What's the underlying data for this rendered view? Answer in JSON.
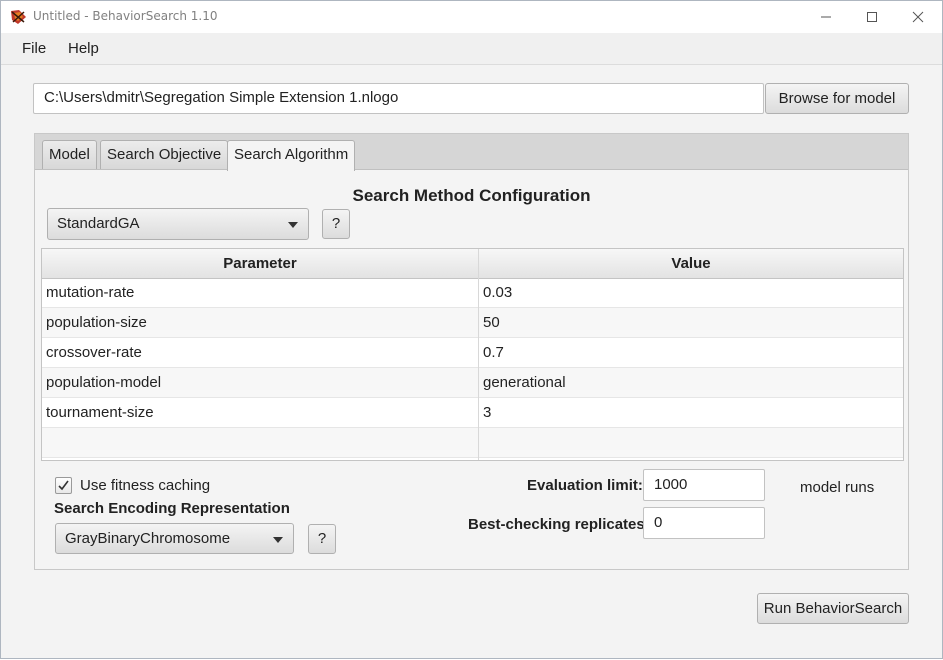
{
  "window": {
    "title": "Untitled - BehaviorSearch 1.10"
  },
  "menu": {
    "items": [
      "File",
      "Help"
    ]
  },
  "model": {
    "path": "C:\\Users\\dmitr\\Segregation Simple Extension 1.nlogo",
    "browse_label": "Browse for model"
  },
  "tabs": [
    {
      "label": "Model",
      "selected": false
    },
    {
      "label": "Search Objective",
      "selected": false
    },
    {
      "label": "Search Algorithm",
      "selected": true
    }
  ],
  "search_method": {
    "title": "Search Method Configuration",
    "selected": "StandardGA",
    "help_label": "?"
  },
  "params_table": {
    "columns": [
      "Parameter",
      "Value"
    ],
    "rows": [
      {
        "parameter": "mutation-rate",
        "value": "0.03"
      },
      {
        "parameter": "population-size",
        "value": "50"
      },
      {
        "parameter": "crossover-rate",
        "value": "0.7"
      },
      {
        "parameter": "population-model",
        "value": "generational"
      },
      {
        "parameter": "tournament-size",
        "value": "3"
      }
    ]
  },
  "fitness_caching": {
    "label": "Use fitness caching",
    "checked": true
  },
  "encoding": {
    "label": "Search Encoding Representation",
    "selected": "GrayBinaryChromosome",
    "help_label": "?"
  },
  "evaluation": {
    "label": "Evaluation limit:",
    "value": "1000",
    "unit": "model runs"
  },
  "replicates": {
    "label": "Best-checking replicates:",
    "value": "0"
  },
  "run_button": {
    "label": "Run BehaviorSearch"
  },
  "colors": {
    "app_icon_red": "#c0392b",
    "tab_header_bg": "#d6d6d6",
    "window_bg": "#f3f3f3"
  }
}
